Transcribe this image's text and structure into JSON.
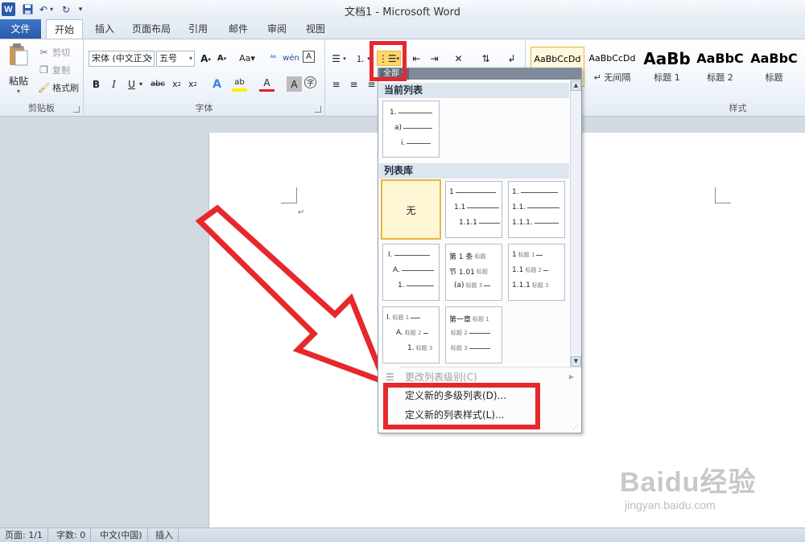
{
  "window": {
    "title": "文档1 - Microsoft Word",
    "logo_letter": "W"
  },
  "tabs": [
    "文件",
    "开始",
    "插入",
    "页面布局",
    "引用",
    "邮件",
    "审阅",
    "视图"
  ],
  "clipboard": {
    "paste": "粘贴",
    "cut": "剪切",
    "copy": "复制",
    "format_painter": "格式刷",
    "group": "剪贴板"
  },
  "font": {
    "name": "宋体 (中文正文",
    "size": "五号",
    "group": "字体"
  },
  "styles": {
    "group": "样式",
    "items": [
      {
        "preview": "AaBbCcDd",
        "name": ""
      },
      {
        "preview": "AaBbCcDd",
        "name": "↵ 无间隔"
      },
      {
        "preview": "AaBb",
        "name": "标题 1"
      },
      {
        "preview": "AaBbC",
        "name": "标题 2"
      },
      {
        "preview": "AaBbC",
        "name": "标题"
      }
    ]
  },
  "menu": {
    "header": "全部",
    "current_list": "当前列表",
    "library": "列表库",
    "none": "无",
    "change_level": "更改列表级别(C)",
    "define_multilevel": "定义新的多级列表(D)...",
    "define_style": "定义新的列表样式(L)..."
  },
  "thumbnails": {
    "current": [
      "1.",
      "a)",
      "i."
    ],
    "t1": [
      "1",
      "1.1",
      "1.1.1"
    ],
    "t2": [
      "1.",
      "1.1.",
      "1.1.1."
    ],
    "t3": [
      "I.",
      "A.",
      "1."
    ],
    "t4": [
      {
        "num": "第 1 条",
        "sub": "标题"
      },
      {
        "num": "节 1.01",
        "sub": "标题"
      },
      {
        "num": "(a)",
        "sub": "标题 3"
      }
    ],
    "t5": [
      {
        "num": "1",
        "sub": "标题 1"
      },
      {
        "num": "1.1",
        "sub": "标题 2"
      },
      {
        "num": "1.1.1",
        "sub": "标题 3"
      }
    ],
    "t6": [
      {
        "num": "I.",
        "sub": "标题 1"
      },
      {
        "num": "A.",
        "sub": "标题 2"
      },
      {
        "num": "1.",
        "sub": "标题 3"
      }
    ],
    "t7": [
      {
        "num": "第一章",
        "sub": "标题 1"
      },
      {
        "num": "",
        "sub": "标题 2"
      },
      {
        "num": "",
        "sub": "标题 3"
      }
    ]
  },
  "status": {
    "page": "页面: 1/1",
    "words": "字数: 0",
    "lang": "中文(中国)",
    "mode": "插入"
  },
  "watermark": {
    "logo": "Baidu经验",
    "url": "jingyan.baidu.com"
  },
  "colors": {
    "annotation": "#e6282d",
    "accent": "#2a5aa8",
    "selection": "#e9b63b"
  }
}
